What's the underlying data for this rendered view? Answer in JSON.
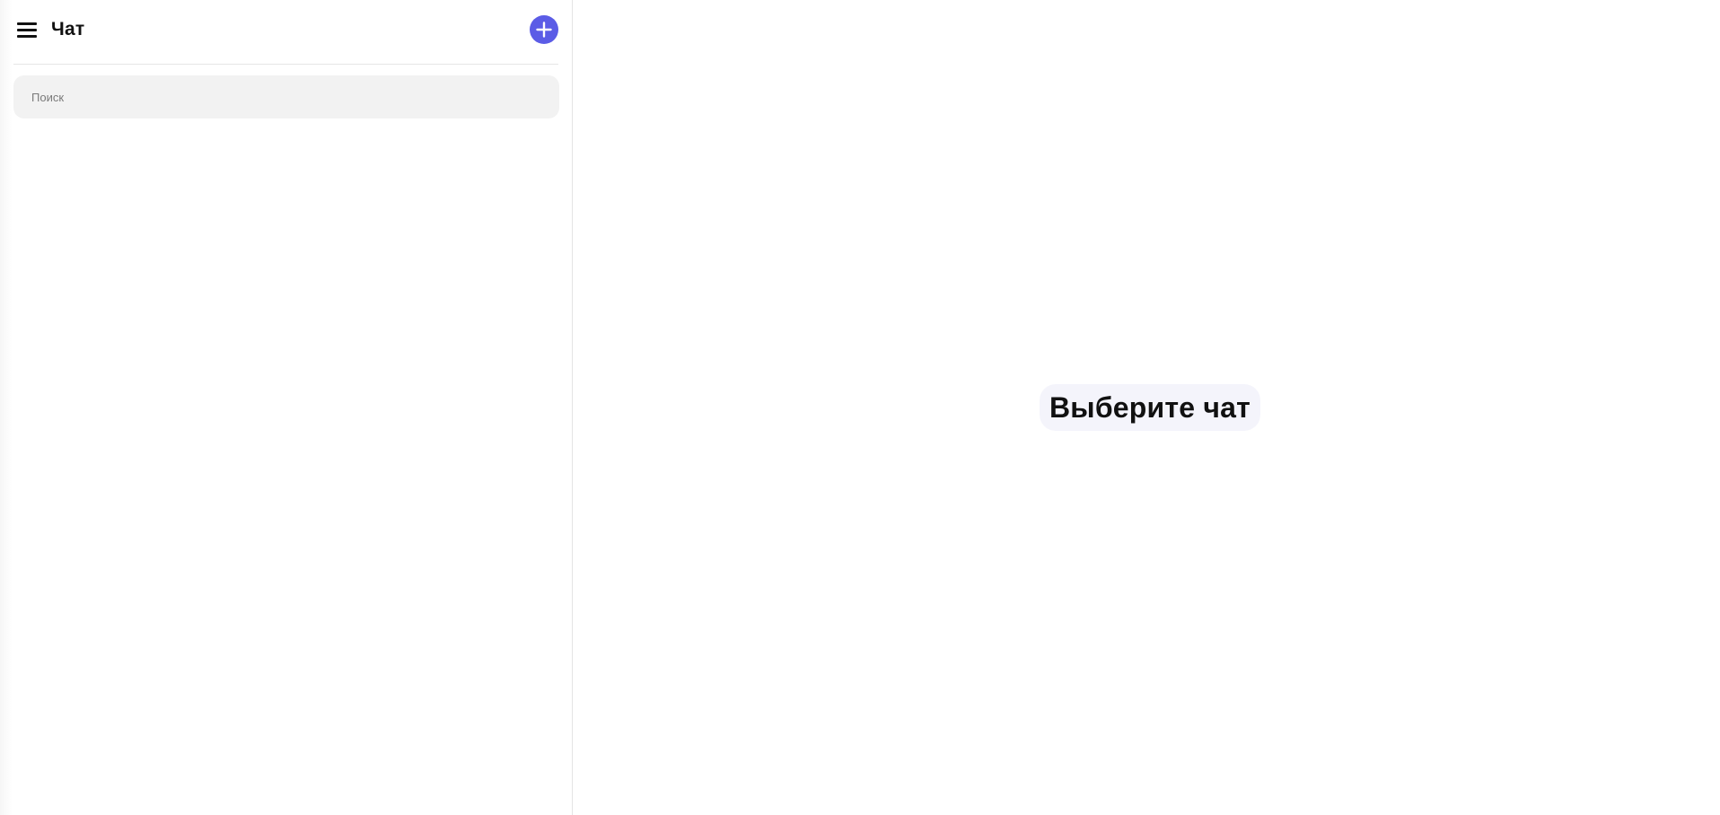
{
  "sidebar": {
    "title": "Чат",
    "menu_icon": "hamburger-menu-icon",
    "add_icon": "plus-icon",
    "search": {
      "placeholder": "Поиск",
      "value": ""
    }
  },
  "main": {
    "empty_state_text": "Выберите чат"
  },
  "colors": {
    "accent": "#5b5ce6",
    "search_bg": "#f2f2f2",
    "empty_pill_bg": "#f4f4fb",
    "divider": "#e4e4e4"
  }
}
